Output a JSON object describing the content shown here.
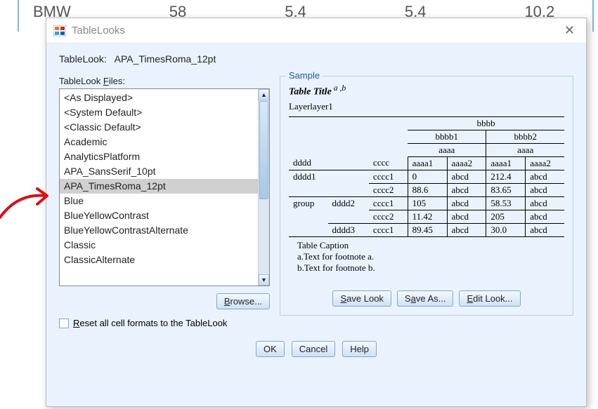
{
  "background": {
    "row": [
      "BMW",
      "58",
      "5.4",
      "5.4",
      "10.2"
    ]
  },
  "dialog": {
    "title": "TableLooks",
    "heading_label": "TableLook:",
    "heading_value": "APA_TimesRoma_12pt",
    "files_label": "TableLook Files:",
    "files": [
      "<As Displayed>",
      "<System Default>",
      "<Classic Default>",
      "Academic",
      "AnalyticsPlatform",
      "APA_SansSerif_10pt",
      "APA_TimesRoma_12pt",
      "Blue",
      "BlueYellowContrast",
      "BlueYellowContrastAlternate",
      "Classic",
      "ClassicAlternate"
    ],
    "selected_index": 6,
    "browse": "Browse...",
    "reset_label": "Reset all cell formats to the TableLook",
    "sample_legend": "Sample",
    "sample": {
      "title": "Table Title",
      "title_super": " a ,b",
      "layer": "Layerlayer1",
      "caption": "Table Caption",
      "footnote_a": "a.Text for footnote a.",
      "footnote_b": "b.Text for footnote b.",
      "labels": {
        "bbbb": "bbbb",
        "bbbb1": "bbbb1",
        "bbbb2": "bbbb2",
        "aaaa": "aaaa",
        "aaaa1": "aaaa1",
        "aaaa2": "aaaa2",
        "dddd": "dddd",
        "cccc": "cccc",
        "dddd1": "dddd1",
        "dddd2": "dddd2",
        "dddd3": "dddd3",
        "cccc1": "cccc1",
        "cccc2": "cccc2",
        "group": "group",
        "abcd": "abcd"
      },
      "data": {
        "r1": [
          "0",
          "abcd",
          "212.4",
          "abcd"
        ],
        "r2": [
          "88.6",
          "abcd",
          "83.65",
          "abcd"
        ],
        "r3": [
          "105",
          "abcd",
          "58.53",
          "abcd"
        ],
        "r4": [
          "11.42",
          "abcd",
          "205",
          "abcd"
        ],
        "r5": [
          "89.45",
          "abcd",
          "30.0",
          "abcd"
        ]
      }
    },
    "buttons": {
      "save_look": "Save Look",
      "save_as": "Save As...",
      "edit_look": "Edit Look...",
      "ok": "OK",
      "cancel": "Cancel",
      "help": "Help"
    }
  }
}
